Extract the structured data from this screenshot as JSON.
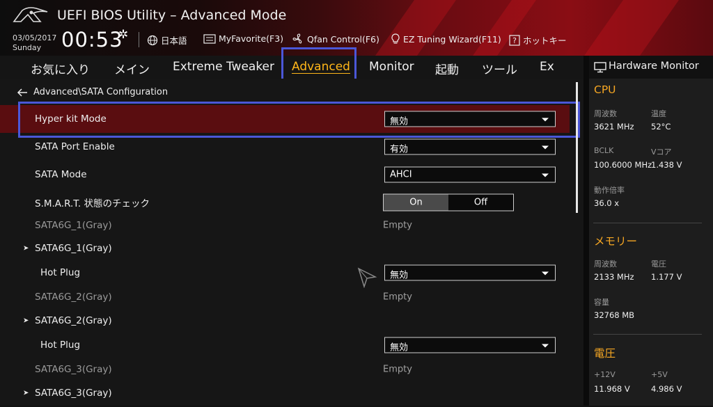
{
  "app": {
    "title": "UEFI BIOS Utility – Advanced Mode",
    "date": "03/05/2017",
    "day": "Sunday",
    "time": "00:53"
  },
  "toolbar": {
    "language": "日本語",
    "my_favorite": "MyFavorite(F3)",
    "qfan": "Qfan Control(F6)",
    "ez_tuning": "EZ Tuning Wizard(F11)",
    "hotkey": "ホットキー"
  },
  "tabs": [
    {
      "label": "お気に入り"
    },
    {
      "label": "メイン"
    },
    {
      "label": "Extreme Tweaker"
    },
    {
      "label": "Advanced"
    },
    {
      "label": "Monitor"
    },
    {
      "label": "起動"
    },
    {
      "label": "ツール"
    },
    {
      "label": "Ex"
    }
  ],
  "active_tab": "Advanced",
  "breadcrumb": "Advanced\\SATA Configuration",
  "settings": [
    {
      "label": "Hyper kit Mode",
      "value": "無効"
    },
    {
      "label": "SATA Port Enable",
      "value": "有効"
    },
    {
      "label": "SATA Mode",
      "value": "AHCI"
    },
    {
      "label": "S.M.A.R.T. 状態のチェック",
      "on": "On",
      "off": "Off",
      "selected": "On"
    },
    {
      "label": "SATA6G_1(Gray)",
      "value": "Empty"
    },
    {
      "label": "SATA6G_1(Gray)"
    },
    {
      "label": "Hot Plug",
      "value": "無効"
    },
    {
      "label": "SATA6G_2(Gray)",
      "value": "Empty"
    },
    {
      "label": "SATA6G_2(Gray)"
    },
    {
      "label": "Hot Plug",
      "value": "無効"
    },
    {
      "label": "SATA6G_3(Gray)",
      "value": "Empty"
    },
    {
      "label": "SATA6G_3(Gray)"
    }
  ],
  "hw_monitor": {
    "title": "Hardware Monitor",
    "cpu": {
      "section": "CPU",
      "freq_label": "周波数",
      "freq": "3621 MHz",
      "temp_label": "温度",
      "temp": "52°C",
      "bclk_label": "BCLK",
      "bclk": "100.6000 MHz",
      "vcore_label": "Vコア",
      "vcore": "1.438 V",
      "ratio_label": "動作倍率",
      "ratio": "36.0 x"
    },
    "memory": {
      "section": "メモリー",
      "freq_label": "周波数",
      "freq": "2133 MHz",
      "volt_label": "電圧",
      "volt": "1.177 V",
      "cap_label": "容量",
      "cap": "32768 MB"
    },
    "voltage": {
      "section": "電圧",
      "v12_label": "+12V",
      "v12": "11.968 V",
      "v5_label": "+5V",
      "v5": "4.986 V"
    }
  },
  "colors": {
    "accent": "#ffb619",
    "highlight_box": "#4b57d8",
    "selected_row": "#5a0d10",
    "hw_section": "#f5a623"
  }
}
